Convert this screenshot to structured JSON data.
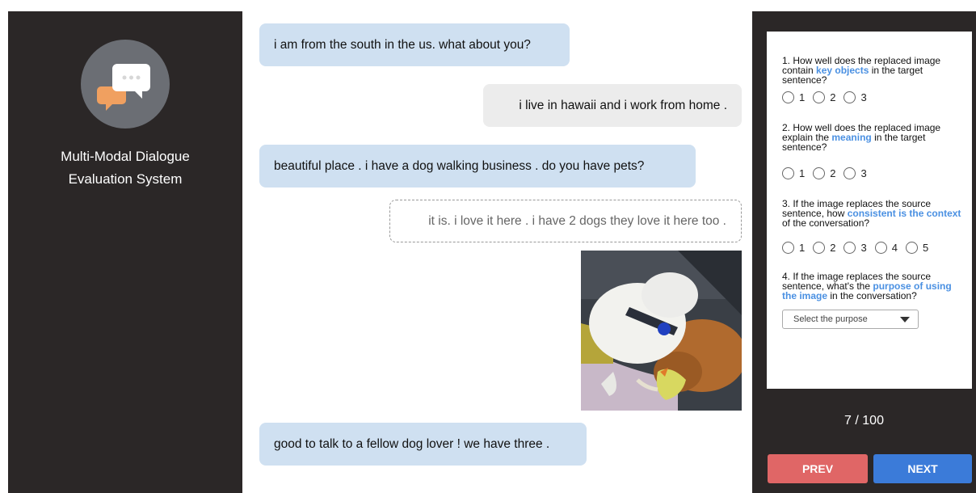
{
  "app": {
    "title_line1": "Multi-Modal Dialogue",
    "title_line2": "Evaluation System"
  },
  "chat": {
    "messages": [
      {
        "side": "left",
        "text": "i am from the south in the us. what about you?"
      },
      {
        "side": "right",
        "text": "i live in hawaii and i work from home ."
      },
      {
        "side": "left",
        "text": "beautiful place . i have a dog walking business . do you have pets?"
      },
      {
        "side": "right",
        "style": "dashed-target",
        "text": "it is. i love it here . i have 2 dogs they love it here too ."
      },
      {
        "side": "right",
        "type": "image",
        "description_icon": "photo-two-dogs-sleeping"
      },
      {
        "side": "left",
        "text": "good to talk to a fellow dog lover ! we have three ."
      }
    ]
  },
  "survey": {
    "q1": {
      "pre": "1. How well does the replaced image contain ",
      "kw": "key objects",
      "post": " in the target sentence?",
      "options": [
        "1",
        "2",
        "3"
      ]
    },
    "q2": {
      "pre": "2. How well does the replaced image explain the ",
      "kw": "meaning",
      "post": " in the target sentence?",
      "options": [
        "1",
        "2",
        "3"
      ]
    },
    "q3": {
      "pre": "3. If the image replaces the source sentence, how ",
      "kw": "consistent is the context",
      "post": " of the conversation?",
      "options": [
        "1",
        "2",
        "3",
        "4",
        "5"
      ]
    },
    "q4": {
      "pre": "4. If the image replaces the source sentence, what's the ",
      "kw": "purpose of using the image",
      "post": " in the conversation?",
      "select_placeholder": "Select the purpose"
    }
  },
  "pager": {
    "counter": "7 / 100",
    "prev": "PREV",
    "next": "NEXT"
  },
  "colors": {
    "panel": "#2b2727",
    "bubble_in": "#cfe0f1",
    "bubble_out": "#ececec",
    "keyword": "#4a90e2",
    "prev": "#e06666",
    "next": "#3b7bd9"
  }
}
